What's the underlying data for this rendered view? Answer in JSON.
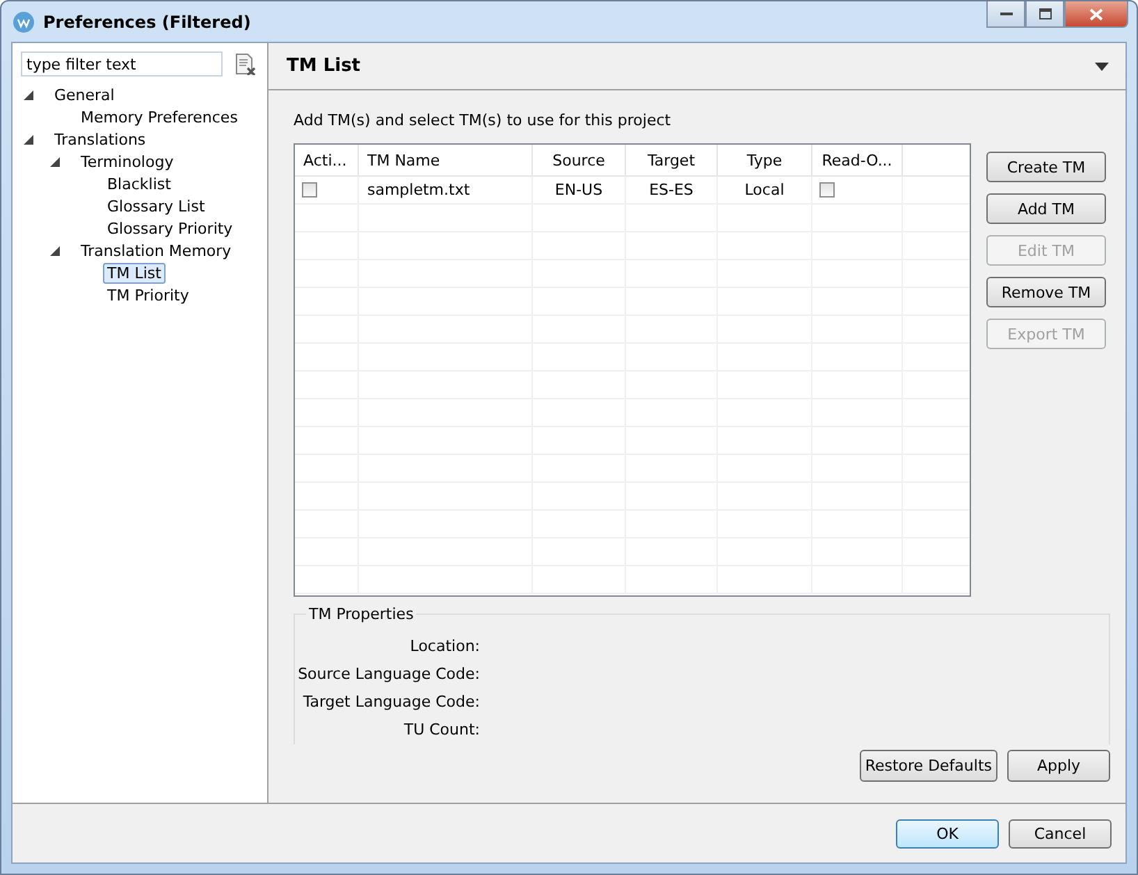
{
  "window": {
    "title": "Preferences (Filtered)"
  },
  "filter": {
    "placeholder": "type filter text"
  },
  "tree": [
    {
      "label": "General",
      "expanded": true,
      "selected": false,
      "children": [
        {
          "label": "Memory Preferences",
          "selected": false
        }
      ]
    },
    {
      "label": "Translations",
      "expanded": true,
      "selected": false,
      "children": [
        {
          "label": "Terminology",
          "expanded": true,
          "selected": false,
          "children": [
            {
              "label": "Blacklist",
              "selected": false
            },
            {
              "label": "Glossary List",
              "selected": false
            },
            {
              "label": "Glossary Priority",
              "selected": false
            }
          ]
        },
        {
          "label": "Translation Memory",
          "expanded": true,
          "selected": false,
          "children": [
            {
              "label": "TM List",
              "selected": true
            },
            {
              "label": "TM Priority",
              "selected": false
            }
          ]
        }
      ]
    }
  ],
  "page": {
    "title": "TM List",
    "description": "Add TM(s) and select TM(s) to use for this project"
  },
  "table": {
    "columns": [
      "Acti...",
      "TM Name",
      "Source",
      "Target",
      "Type",
      "Read-O..."
    ],
    "rows": [
      {
        "active": false,
        "name": "sampletm.txt",
        "source": "EN-US",
        "target": "ES-ES",
        "type": "Local",
        "read_only": false
      }
    ]
  },
  "side_buttons": [
    {
      "label": "Create TM",
      "disabled": false
    },
    {
      "label": "Add TM",
      "disabled": false
    },
    {
      "label": "Edit TM",
      "disabled": true
    },
    {
      "label": "Remove TM",
      "disabled": false
    },
    {
      "label": "Export TM",
      "disabled": true
    }
  ],
  "properties": {
    "title": "TM Properties",
    "fields": [
      "Location:",
      "Source Language Code:",
      "Target Language Code:",
      "TU Count:"
    ]
  },
  "page_buttons": [
    "Restore Defaults",
    "Apply"
  ],
  "dialog_buttons": [
    {
      "label": "OK",
      "default": true
    },
    {
      "label": "Cancel",
      "default": false
    }
  ]
}
